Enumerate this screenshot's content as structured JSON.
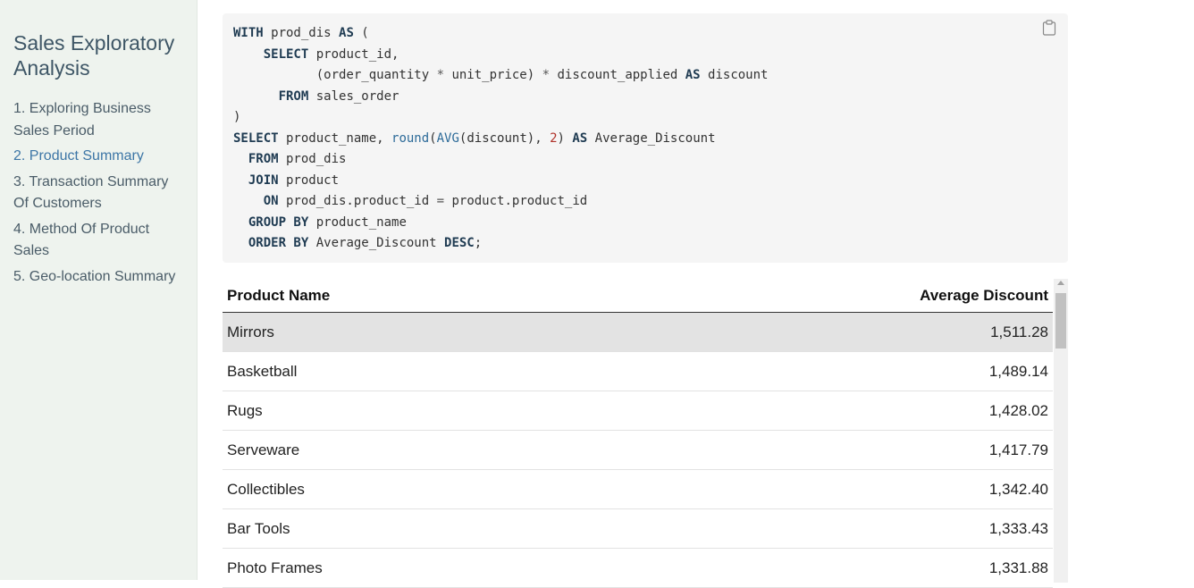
{
  "sidebar": {
    "title": "Sales Exploratory Analysis",
    "items": [
      {
        "label": "1. Exploring Business Sales Period",
        "active": false
      },
      {
        "label": "2. Product Summary",
        "active": true
      },
      {
        "label": "3. Transaction Summary Of Customers",
        "active": false
      },
      {
        "label": "4. Method Of Product Sales",
        "active": false
      },
      {
        "label": "5. Geo-location Summary",
        "active": false
      }
    ]
  },
  "code": {
    "lines": [
      [
        {
          "t": "kw",
          "v": "WITH"
        },
        {
          "t": "",
          "v": " prod_dis "
        },
        {
          "t": "kw",
          "v": "AS"
        },
        {
          "t": "",
          "v": " ("
        }
      ],
      [
        {
          "t": "",
          "v": "    "
        },
        {
          "t": "kw",
          "v": "SELECT"
        },
        {
          "t": "",
          "v": " product_id,"
        }
      ],
      [
        {
          "t": "",
          "v": "           (order_quantity "
        },
        {
          "t": "op",
          "v": "*"
        },
        {
          "t": "",
          "v": " unit_price) "
        },
        {
          "t": "op",
          "v": "*"
        },
        {
          "t": "",
          "v": " discount_applied "
        },
        {
          "t": "kw",
          "v": "AS"
        },
        {
          "t": "",
          "v": " discount"
        }
      ],
      [
        {
          "t": "",
          "v": "      "
        },
        {
          "t": "kw",
          "v": "FROM"
        },
        {
          "t": "",
          "v": " sales_order"
        }
      ],
      [
        {
          "t": "",
          "v": ")"
        }
      ],
      [
        {
          "t": "kw",
          "v": "SELECT"
        },
        {
          "t": "",
          "v": " product_name, "
        },
        {
          "t": "fn",
          "v": "round"
        },
        {
          "t": "",
          "v": "("
        },
        {
          "t": "fn",
          "v": "AVG"
        },
        {
          "t": "",
          "v": "(discount), "
        },
        {
          "t": "num",
          "v": "2"
        },
        {
          "t": "",
          "v": ") "
        },
        {
          "t": "kw",
          "v": "AS"
        },
        {
          "t": "",
          "v": " Average_Discount"
        }
      ],
      [
        {
          "t": "",
          "v": "  "
        },
        {
          "t": "kw",
          "v": "FROM"
        },
        {
          "t": "",
          "v": " prod_dis"
        }
      ],
      [
        {
          "t": "",
          "v": "  "
        },
        {
          "t": "kw",
          "v": "JOIN"
        },
        {
          "t": "",
          "v": " product"
        }
      ],
      [
        {
          "t": "",
          "v": "    "
        },
        {
          "t": "kw",
          "v": "ON"
        },
        {
          "t": "",
          "v": " prod_dis.product_id "
        },
        {
          "t": "op",
          "v": "="
        },
        {
          "t": "",
          "v": " product.product_id"
        }
      ],
      [
        {
          "t": "",
          "v": "  "
        },
        {
          "t": "kw",
          "v": "GROUP BY"
        },
        {
          "t": "",
          "v": " product_name"
        }
      ],
      [
        {
          "t": "",
          "v": "  "
        },
        {
          "t": "kw",
          "v": "ORDER BY"
        },
        {
          "t": "",
          "v": " Average_Discount "
        },
        {
          "t": "kw",
          "v": "DESC"
        },
        {
          "t": "",
          "v": ";"
        }
      ]
    ]
  },
  "table": {
    "headers": [
      "Product Name",
      "Average Discount"
    ],
    "rows": [
      [
        "Mirrors",
        "1,511.28"
      ],
      [
        "Basketball",
        "1,489.14"
      ],
      [
        "Rugs",
        "1,428.02"
      ],
      [
        "Serveware",
        "1,417.79"
      ],
      [
        "Collectibles",
        "1,342.40"
      ],
      [
        "Bar Tools",
        "1,333.43"
      ],
      [
        "Photo Frames",
        "1,331.88"
      ]
    ]
  },
  "icons": {
    "copy": "clipboard-icon"
  }
}
